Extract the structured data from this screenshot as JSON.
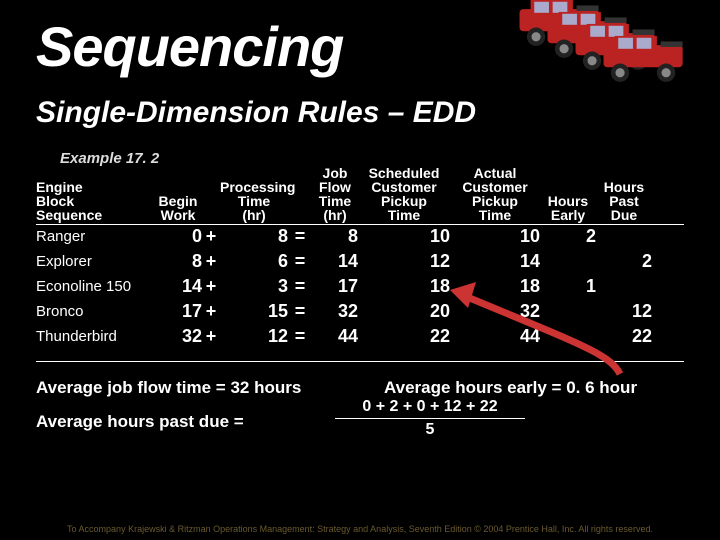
{
  "title": "Sequencing",
  "subtitle": "Single-Dimension Rules – EDD",
  "example_label": "Example 17. 2",
  "headers": {
    "name": "Engine\nBlock\nSequence",
    "begin": "Begin\nWork",
    "processing": "Processing\nTime\n(hr)",
    "flow": "Job\nFlow\nTime\n(hr)",
    "scheduled": "Scheduled\nCustomer\nPickup\nTime",
    "actual": "Actual\nCustomer\nPickup\nTime",
    "early": "Hours\nEarly",
    "past": "Hours\nPast\nDue"
  },
  "rows": [
    {
      "name": "Ranger",
      "begin": "0",
      "op": "+",
      "proc": "8",
      "eq": "=",
      "flow": "8",
      "sched": "10",
      "act": "10",
      "early": "2",
      "past": ""
    },
    {
      "name": "Explorer",
      "begin": "8",
      "op": "+",
      "proc": "6",
      "eq": "=",
      "flow": "14",
      "sched": "12",
      "act": "14",
      "early": "",
      "past": "2"
    },
    {
      "name": "Econoline 150",
      "begin": "14",
      "op": "+",
      "proc": "3",
      "eq": "=",
      "flow": "17",
      "sched": "18",
      "act": "18",
      "early": "1",
      "past": ""
    },
    {
      "name": "Bronco",
      "begin": "17",
      "op": "+",
      "proc": "15",
      "eq": "=",
      "flow": "32",
      "sched": "20",
      "act": "32",
      "early": "",
      "past": "12"
    },
    {
      "name": "Thunderbird",
      "begin": "32",
      "op": "+",
      "proc": "12",
      "eq": "=",
      "flow": "44",
      "sched": "22",
      "act": "44",
      "early": "",
      "past": "22"
    }
  ],
  "avg_flow": "Average job flow time = 32 hours",
  "avg_early": "Average hours early = 0. 6 hour",
  "avg_past_label": "Average hours past due =",
  "frac_num": "0 + 2 + 0 + 12 + 22",
  "frac_den": "5",
  "footer": "To Accompany Krajewski & Ritzman Operations Management: Strategy and Analysis, Seventh Edition © 2004 Prentice Hall, Inc. All rights reserved.",
  "chart_data": {
    "type": "table",
    "title": "Single-Dimension Rules – EDD (Example 17.2)",
    "columns": [
      "Engine Block Sequence",
      "Begin Work",
      "Processing Time (hr)",
      "Job Flow Time (hr)",
      "Scheduled Customer Pickup Time",
      "Actual Customer Pickup Time",
      "Hours Early",
      "Hours Past Due"
    ],
    "rows": [
      [
        "Ranger",
        0,
        8,
        8,
        10,
        10,
        2,
        null
      ],
      [
        "Explorer",
        8,
        6,
        14,
        12,
        14,
        null,
        2
      ],
      [
        "Econoline 150",
        14,
        3,
        17,
        18,
        18,
        1,
        null
      ],
      [
        "Bronco",
        17,
        15,
        32,
        20,
        32,
        null,
        12
      ],
      [
        "Thunderbird",
        32,
        12,
        44,
        22,
        44,
        null,
        22
      ]
    ],
    "summary": {
      "average_job_flow_time_hr": 32,
      "average_hours_early": 0.6,
      "average_hours_past_due_expr": "(0+2+0+12+22)/5"
    }
  }
}
